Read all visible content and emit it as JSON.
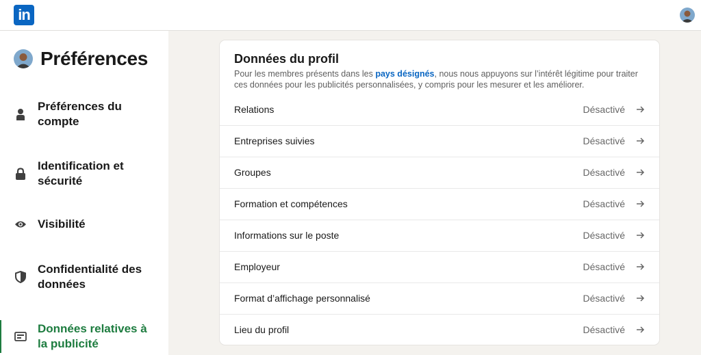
{
  "topbar": {
    "logo_text": "in",
    "logo_icon": "linkedin-logo",
    "avatar_icon": "user-avatar"
  },
  "sidebar": {
    "title": "Préférences",
    "avatar_icon": "user-avatar",
    "items": [
      {
        "label": "Préférences du compte",
        "icon": "person-icon",
        "active": false
      },
      {
        "label": "Identification et sécurité",
        "icon": "lock-icon",
        "active": false
      },
      {
        "label": "Visibilité",
        "icon": "eye-icon",
        "active": false
      },
      {
        "label": "Confidentialité des données",
        "icon": "shield-icon",
        "active": false
      },
      {
        "label": "Données relatives à la publicité",
        "icon": "ad-card-icon",
        "active": true
      }
    ]
  },
  "card": {
    "title": "Données du profil",
    "desc_before": "Pour les membres présents dans les ",
    "desc_link": "pays désignés",
    "desc_after": ", nous nous appuyons sur l’intérêt légitime pour traiter ces données pour les publicités personnalisées, y compris pour les mesurer et les améliorer.",
    "rows": [
      {
        "label": "Relations",
        "status": "Désactivé"
      },
      {
        "label": "Entreprises suivies",
        "status": "Désactivé"
      },
      {
        "label": "Groupes",
        "status": "Désactivé"
      },
      {
        "label": "Formation et compétences",
        "status": "Désactivé"
      },
      {
        "label": "Informations sur le poste",
        "status": "Désactivé"
      },
      {
        "label": "Employeur",
        "status": "Désactivé"
      },
      {
        "label": "Format d’affichage personnalisé",
        "status": "Désactivé"
      },
      {
        "label": "Lieu du profil",
        "status": "Désactivé"
      }
    ]
  },
  "colors": {
    "brand": "#0a66c2",
    "active_green": "#1d7c3f",
    "background": "#f4f2ee"
  }
}
